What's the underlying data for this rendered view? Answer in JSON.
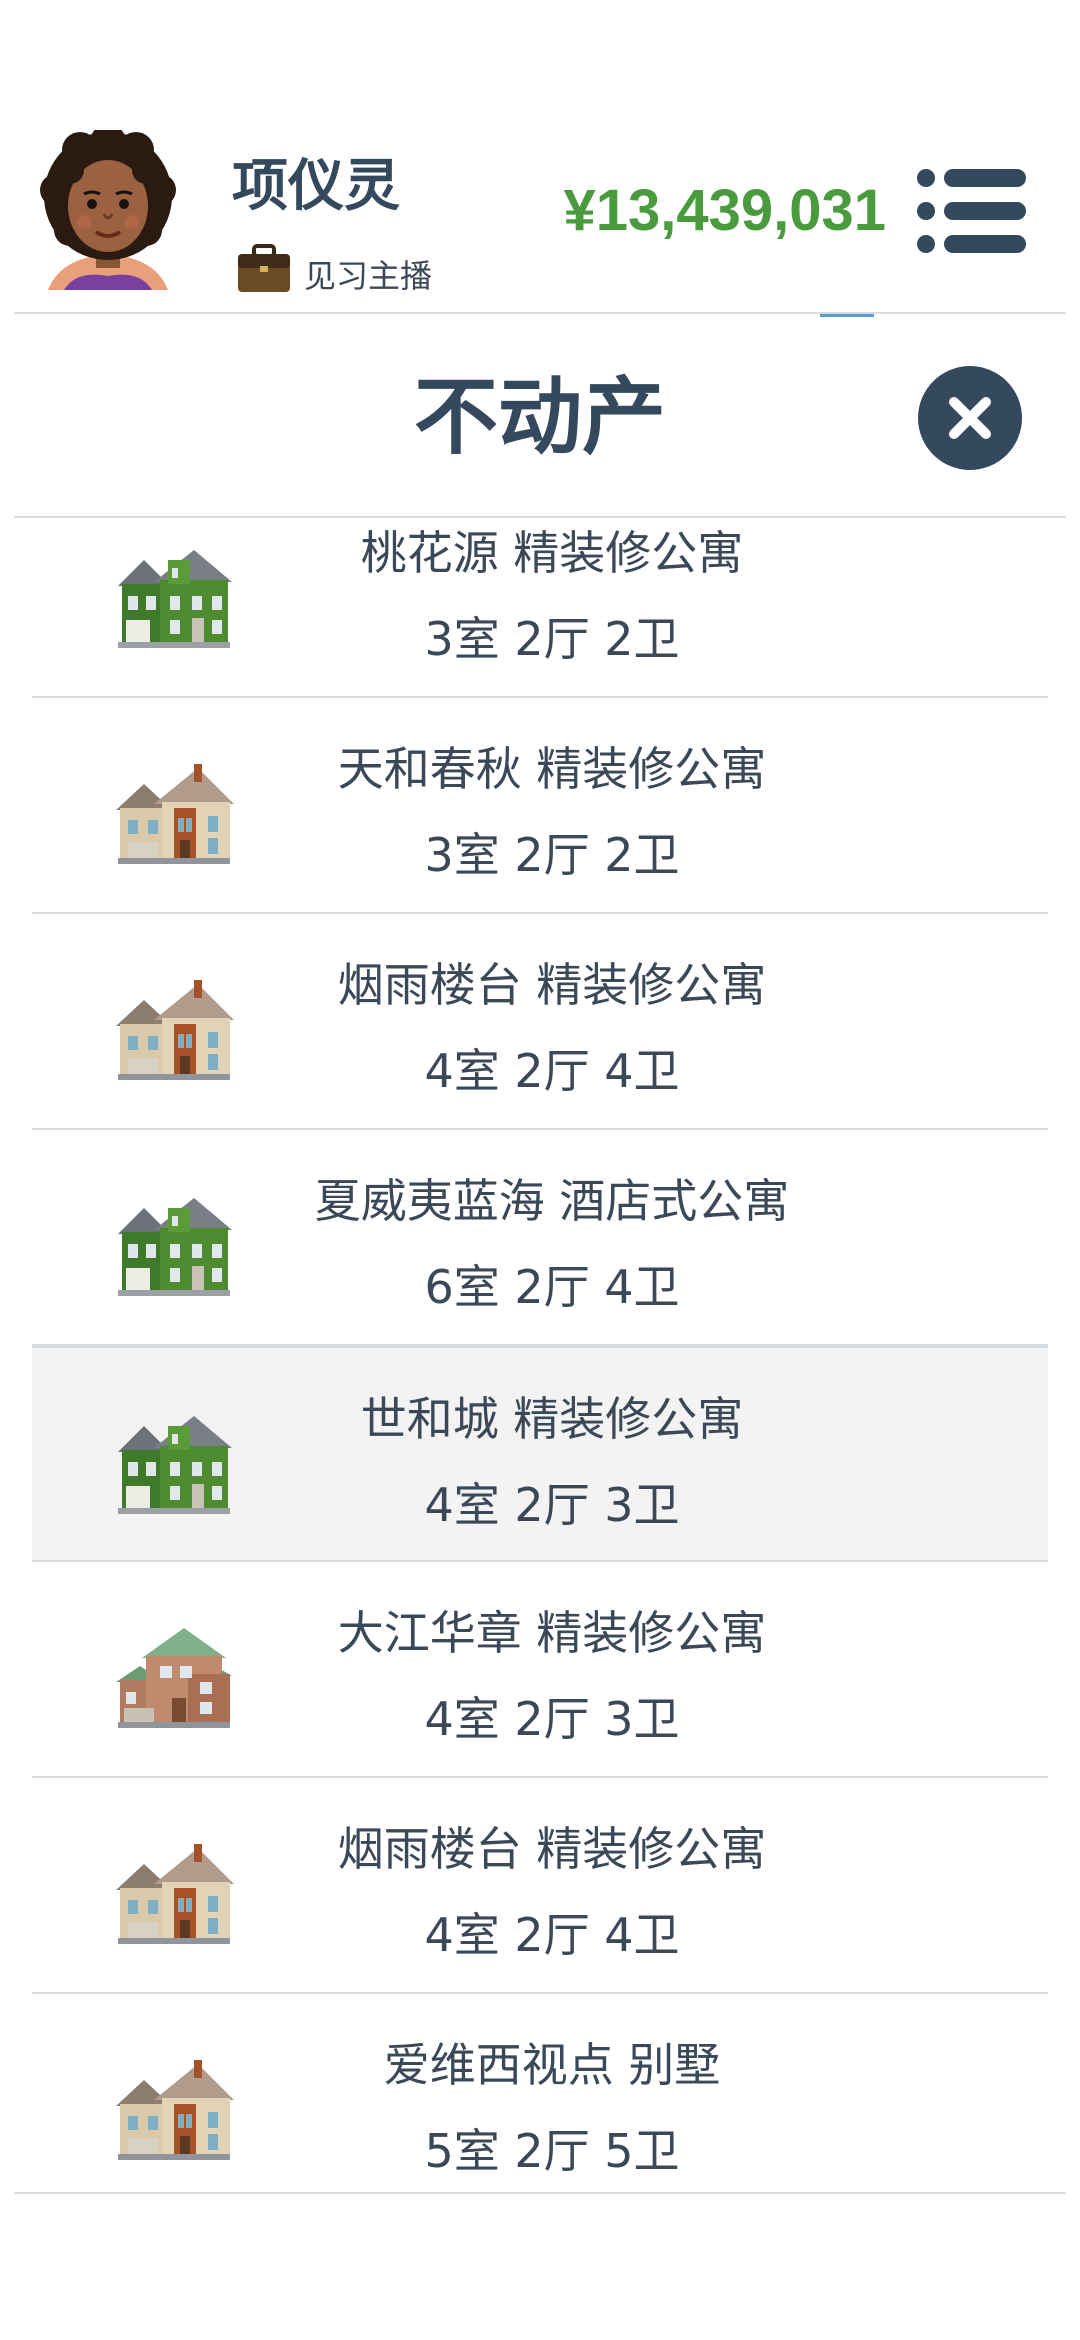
{
  "header": {
    "player_name": "项仪灵",
    "job_title": "见习主播",
    "money": "¥13,439,031",
    "avatar_icon": "woman-avatar-icon",
    "job_icon": "briefcase-icon",
    "menu_icon": "list-menu-icon"
  },
  "page": {
    "title": "不动产",
    "close_icon": "close-icon"
  },
  "colors": {
    "money_green": "#4a9a3e",
    "title_dark": "#34495e",
    "divider": "#d8dde2",
    "highlight_row": "#f3f3f3"
  },
  "properties": [
    {
      "name": "桃花源 精装修公寓",
      "layout": "3室 2厅 2卫",
      "icon": "green-house-icon"
    },
    {
      "name": "天和春秋 精装修公寓",
      "layout": "3室 2厅 2卫",
      "icon": "beige-house-icon"
    },
    {
      "name": "烟雨楼台 精装修公寓",
      "layout": "4室 2厅 4卫",
      "icon": "beige-house-icon"
    },
    {
      "name": "夏威夷蓝海 酒店式公寓",
      "layout": "6室 2厅 4卫",
      "icon": "green-house-icon"
    },
    {
      "name": "世和城 精装修公寓",
      "layout": "4室 2厅 3卫",
      "icon": "green-house-icon",
      "highlighted": true
    },
    {
      "name": "大江华章 精装修公寓",
      "layout": "4室 2厅 3卫",
      "icon": "brick-house-icon"
    },
    {
      "name": "烟雨楼台 精装修公寓",
      "layout": "4室 2厅 4卫",
      "icon": "beige-house-icon"
    },
    {
      "name": "爱维西视点 别墅",
      "layout": "5室 2厅 5卫",
      "icon": "beige-house-icon"
    }
  ]
}
